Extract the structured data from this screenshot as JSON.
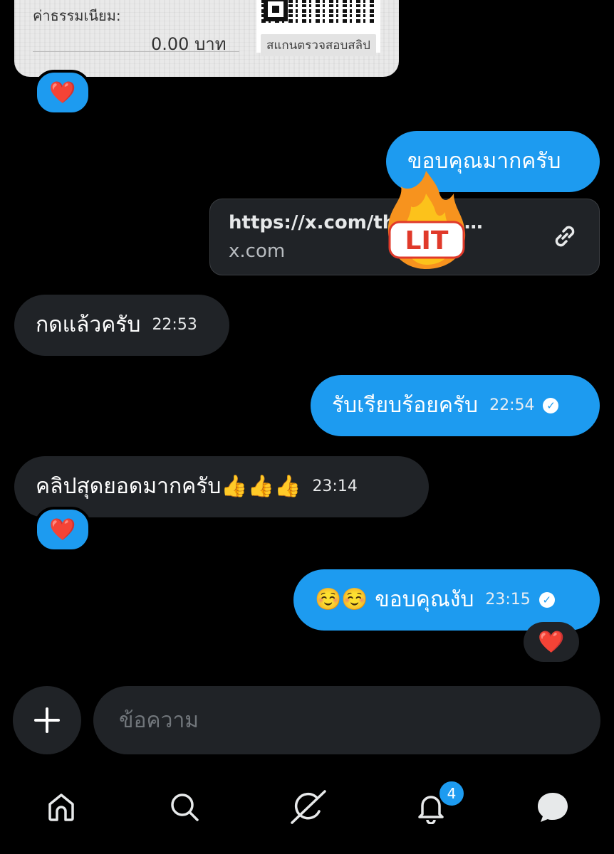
{
  "receipt": {
    "fee_label": "ค่าธรรมเนียม:",
    "fee_amount": "0.00 บาท",
    "scan_label": "สแกนตรวจสอบสลิป"
  },
  "messages": [
    {
      "text": "ขอบคุณมากครับ",
      "direction": "out"
    },
    {
      "link_url": "https://x.com/th…7?s=…",
      "link_domain": "x.com",
      "direction": "out"
    },
    {
      "text": "กดแล้วครับ",
      "time": "22:53",
      "direction": "in"
    },
    {
      "text": "รับเรียบร้อยครับ",
      "time": "22:54",
      "direction": "out"
    },
    {
      "text": "คลิปสุดยอดมากครับ👍👍👍",
      "time": "23:14",
      "direction": "in"
    },
    {
      "text": "☺️☺️ ขอบคุณงับ",
      "time": "23:15",
      "direction": "out"
    }
  ],
  "reactions": {
    "receipt": "❤️",
    "clip_message": "❤️",
    "thanks_message": "❤️"
  },
  "sticker_text": "LIT",
  "composer": {
    "placeholder": "ข้อความ"
  },
  "nav": {
    "notifications_badge": "4",
    "items": [
      "home-icon",
      "search-icon",
      "grok-icon",
      "bell-icon",
      "messages-icon"
    ]
  },
  "colors": {
    "accent": "#1d9bf0",
    "bubble_in": "#202327",
    "background": "#000000"
  }
}
